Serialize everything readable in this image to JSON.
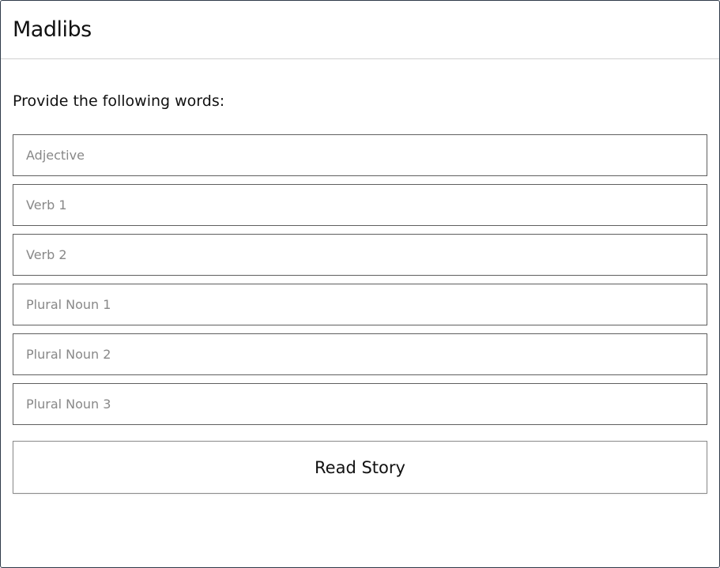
{
  "header": {
    "title": "Madlibs"
  },
  "form": {
    "instructions": "Provide the following words:",
    "fields": [
      {
        "placeholder": "Adjective",
        "value": ""
      },
      {
        "placeholder": "Verb 1",
        "value": ""
      },
      {
        "placeholder": "Verb 2",
        "value": ""
      },
      {
        "placeholder": "Plural Noun 1",
        "value": ""
      },
      {
        "placeholder": "Plural Noun 2",
        "value": ""
      },
      {
        "placeholder": "Plural Noun 3",
        "value": ""
      }
    ],
    "submit_label": "Read Story"
  }
}
